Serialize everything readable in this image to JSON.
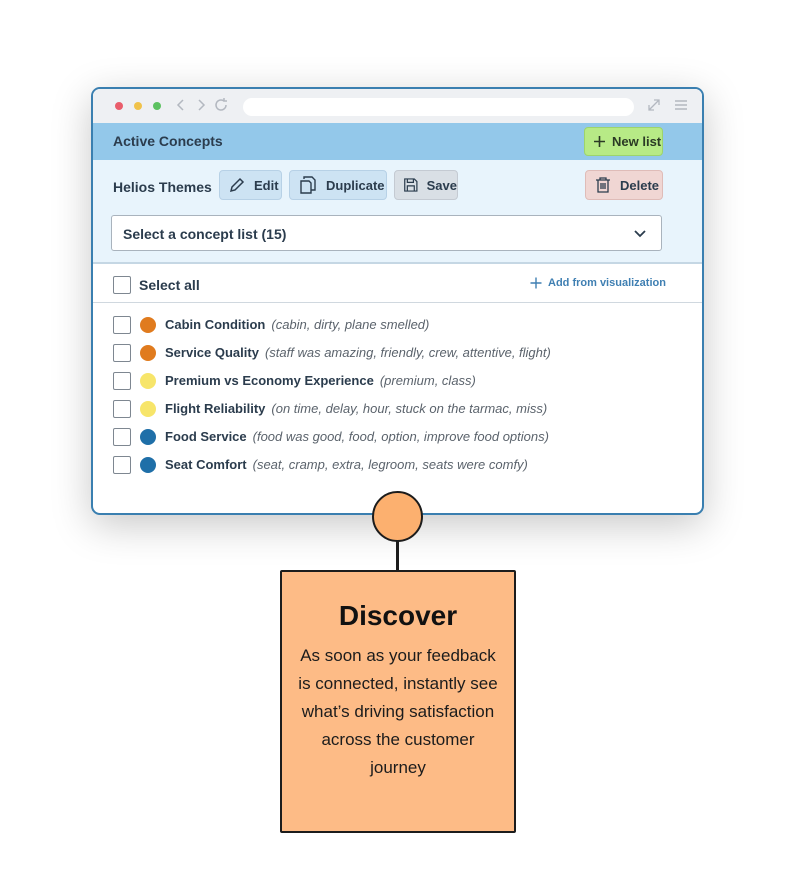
{
  "window": {
    "header": {
      "title": "Active Concepts",
      "new_list_label": "New list"
    },
    "toolbar": {
      "theme_name": "Helios Themes",
      "edit_label": "Edit",
      "duplicate_label": "Duplicate",
      "save_label": "Save",
      "delete_label": "Delete"
    },
    "select": {
      "value": "Select a concept list (15)"
    },
    "select_all": {
      "label": "Select all",
      "add_from_visualization_label": "Add from visualization"
    },
    "concepts": [
      {
        "name": "Cabin Condition",
        "keywords": "(cabin, dirty, plane smelled)",
        "color": "#e07b1e"
      },
      {
        "name": "Service Quality",
        "keywords": "(staff was amazing, friendly, crew, attentive, flight)",
        "color": "#e07b1e"
      },
      {
        "name": "Premium vs Economy Experience",
        "keywords": "(premium, class)",
        "color": "#f7e56a"
      },
      {
        "name": "Flight Reliability",
        "keywords": "(on time, delay, hour, stuck on the tarmac, miss)",
        "color": "#f7e56a"
      },
      {
        "name": "Food Service",
        "keywords": "(food was good, food, option, improve food options)",
        "color": "#1f6fa8"
      },
      {
        "name": "Seat Comfort",
        "keywords": "(seat, cramp, extra, legroom, seats were comfy)",
        "color": "#1f6fa8"
      }
    ]
  },
  "callout": {
    "title": "Discover",
    "body": "As soon as your feedback is connected, instantly see what’s driving satisfaction across the customer journey"
  },
  "colors": {
    "header_bg": "#93c8ea",
    "new_list_bg": "#b7ea86",
    "callout_bg": "#fdbb86"
  }
}
